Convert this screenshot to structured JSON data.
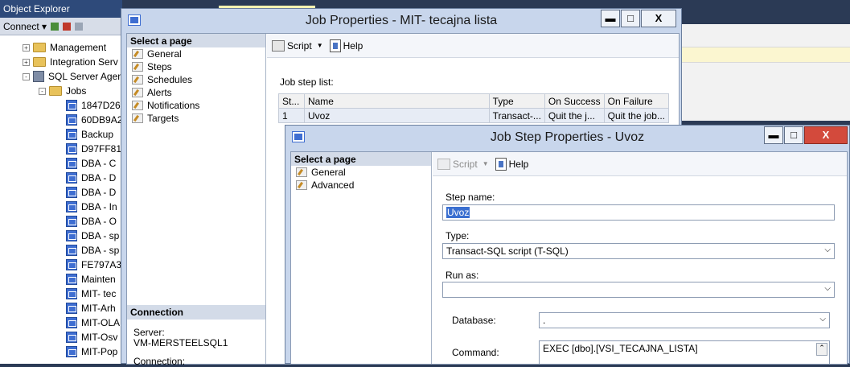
{
  "object_explorer": {
    "title": "Object Explorer",
    "connect_label": "Connect",
    "tree": [
      {
        "label": "Management",
        "kind": "folder",
        "expander": "+"
      },
      {
        "label": "Integration Serv",
        "kind": "folder",
        "expander": "+"
      },
      {
        "label": "SQL Server Agen",
        "kind": "agent",
        "expander": "-"
      },
      {
        "label": "Jobs",
        "kind": "folder",
        "expander": "-"
      },
      {
        "label": "1847D26",
        "kind": "job"
      },
      {
        "label": "60DB9A2",
        "kind": "job"
      },
      {
        "label": "Backup",
        "kind": "job"
      },
      {
        "label": "D97FF81",
        "kind": "job"
      },
      {
        "label": "DBA - C",
        "kind": "job"
      },
      {
        "label": "DBA - D",
        "kind": "job"
      },
      {
        "label": "DBA - D",
        "kind": "job"
      },
      {
        "label": "DBA - In",
        "kind": "job"
      },
      {
        "label": "DBA - O",
        "kind": "job"
      },
      {
        "label": "DBA - sp",
        "kind": "job"
      },
      {
        "label": "DBA - sp",
        "kind": "job"
      },
      {
        "label": "FE797A3",
        "kind": "job"
      },
      {
        "label": "Mainten",
        "kind": "job"
      },
      {
        "label": "MIT- tec",
        "kind": "job"
      },
      {
        "label": "MIT-Arh",
        "kind": "job"
      },
      {
        "label": "MIT-OLA",
        "kind": "job"
      },
      {
        "label": "MIT-Osv",
        "kind": "job"
      },
      {
        "label": "MIT-Pop",
        "kind": "job"
      }
    ]
  },
  "job_window": {
    "title": "Job Properties - MIT- tecajna lista",
    "controls": {
      "minimize": "▬",
      "maximize": "□",
      "close": "X"
    },
    "select_page_header": "Select a page",
    "pages": [
      "General",
      "Steps",
      "Schedules",
      "Alerts",
      "Notifications",
      "Targets"
    ],
    "toolbar": {
      "script": "Script",
      "help": "Help"
    },
    "step_list_label": "Job step list:",
    "columns": [
      "St...",
      "Name",
      "Type",
      "On Success",
      "On Failure"
    ],
    "rows": [
      [
        "1",
        "Uvoz",
        "Transact-...",
        "Quit the j...",
        "Quit the job..."
      ]
    ],
    "connection_header": "Connection",
    "server_label": "Server:",
    "server_value": "VM-MERSTEELSQL1",
    "connection_label": "Connection:"
  },
  "step_window": {
    "title": "Job Step Properties - Uvoz",
    "controls": {
      "minimize": "▬",
      "maximize": "□",
      "close": "X"
    },
    "select_page_header": "Select a page",
    "pages": [
      "General",
      "Advanced"
    ],
    "toolbar": {
      "script": "Script",
      "help": "Help"
    },
    "step_name_label": "Step name:",
    "step_name_value": "Uvoz",
    "type_label": "Type:",
    "type_value": "Transact-SQL script (T-SQL)",
    "run_as_label": "Run as:",
    "run_as_value": "",
    "database_label": "Database:",
    "database_value": ".",
    "command_label": "Command:",
    "command_value": "EXEC [dbo].[VSI_TECAJNA_LISTA]"
  }
}
